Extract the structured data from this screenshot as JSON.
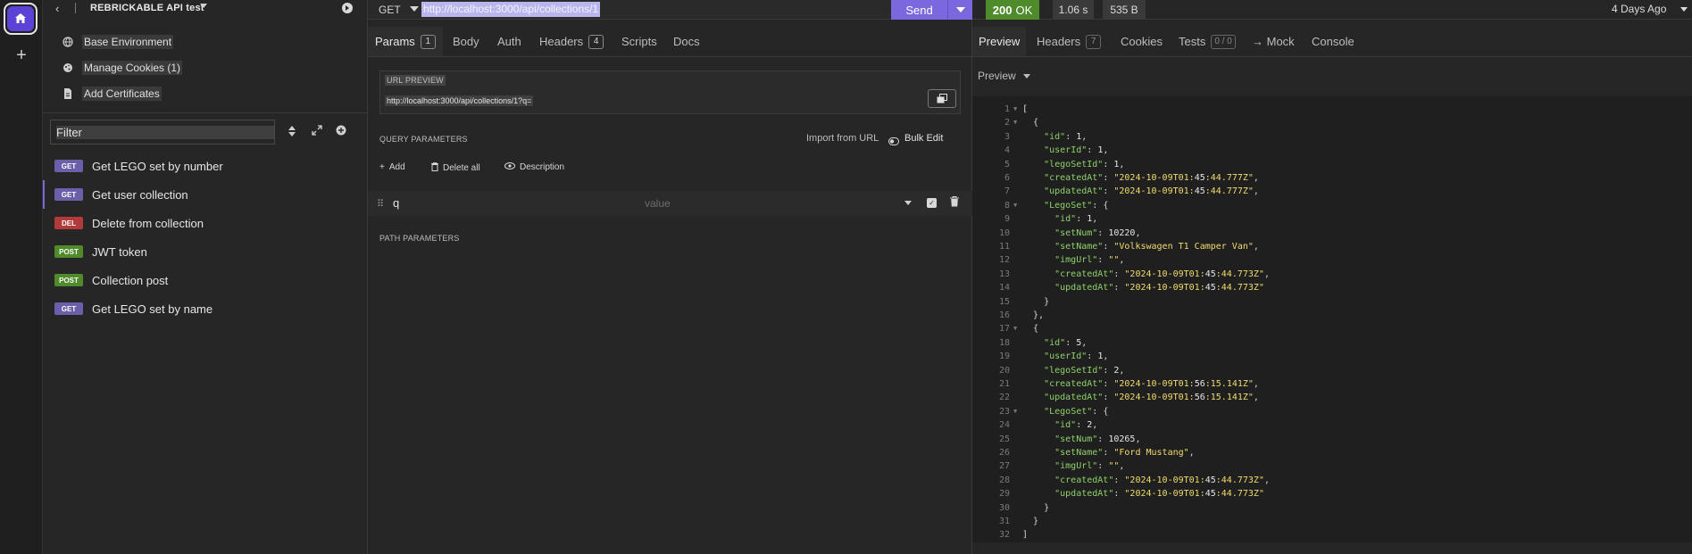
{
  "sidebar": {
    "title": "REBRICKABLE API test",
    "env_items": [
      {
        "label": "Base Environment",
        "icon": "globe-icon"
      },
      {
        "label": "Manage Cookies (1)",
        "icon": "cookie-icon"
      },
      {
        "label": "Add Certificates",
        "icon": "file-icon"
      }
    ],
    "filter_placeholder": "Filter",
    "requests": [
      {
        "method": "GET",
        "name": "Get LEGO set by number"
      },
      {
        "method": "GET",
        "name": "Get user collection"
      },
      {
        "method": "DEL",
        "name": "Delete from collection"
      },
      {
        "method": "POST",
        "name": "JWT token"
      },
      {
        "method": "POST",
        "name": "Collection post"
      },
      {
        "method": "GET",
        "name": "Get LEGO set by name"
      }
    ]
  },
  "request": {
    "method": "GET",
    "url": "http://localhost:3000/api/collections/1",
    "send_label": "Send",
    "tabs": {
      "params": "Params",
      "params_count": "1",
      "body": "Body",
      "auth": "Auth",
      "headers": "Headers",
      "headers_count": "4",
      "scripts": "Scripts",
      "docs": "Docs"
    },
    "url_preview_label": "URL PREVIEW",
    "url_preview": "http://localhost:3000/api/collections/1?q=",
    "query_params_label": "QUERY PARAMETERS",
    "import_from_url": "Import from URL",
    "bulk_edit": "Bulk Edit",
    "add_label": "Add",
    "delete_all_label": "Delete all",
    "description_label": "Description",
    "param": {
      "key": "q",
      "value_placeholder": "value"
    },
    "path_params_label": "PATH PARAMETERS"
  },
  "response": {
    "status_code": "200",
    "status_text": "OK",
    "time": "1.06 s",
    "size": "535 B",
    "time_ago": "4 Days Ago",
    "tabs": {
      "preview": "Preview",
      "headers": "Headers",
      "headers_count": "7",
      "cookies": "Cookies",
      "tests": "Tests",
      "tests_count": "0 / 0",
      "mock": "→ Mock",
      "console": "Console"
    },
    "viewer": "Preview",
    "lines": [
      "[",
      "  {",
      "    \"id\": 1,",
      "    \"userId\": 1,",
      "    \"legoSetId\": 1,",
      "    \"createdAt\": \"2024-10-09T01:45:44.777Z\",",
      "    \"updatedAt\": \"2024-10-09T01:45:44.777Z\",",
      "    \"LegoSet\": {",
      "      \"id\": 1,",
      "      \"setNum\": 10220,",
      "      \"setName\": \"Volkswagen T1 Camper Van\",",
      "      \"imgUrl\": \"\",",
      "      \"createdAt\": \"2024-10-09T01:45:44.773Z\",",
      "      \"updatedAt\": \"2024-10-09T01:45:44.773Z\"",
      "    }",
      "  },",
      "  {",
      "    \"id\": 5,",
      "    \"userId\": 1,",
      "    \"legoSetId\": 2,",
      "    \"createdAt\": \"2024-10-09T01:56:15.141Z\",",
      "    \"updatedAt\": \"2024-10-09T01:56:15.141Z\",",
      "    \"LegoSet\": {",
      "      \"id\": 2,",
      "      \"setNum\": 10265,",
      "      \"setName\": \"Ford Mustang\",",
      "      \"imgUrl\": \"\",",
      "      \"createdAt\": \"2024-10-09T01:45:44.773Z\",",
      "      \"updatedAt\": \"2024-10-09T01:45:44.773Z\"",
      "    }",
      "  }",
      "]"
    ]
  },
  "colors": {
    "accent": "#7b68de",
    "ok": "#4f8a2b",
    "delete": "#b33a3a",
    "json_key": "#8fd16a",
    "json_string": "#f2dc6d"
  }
}
